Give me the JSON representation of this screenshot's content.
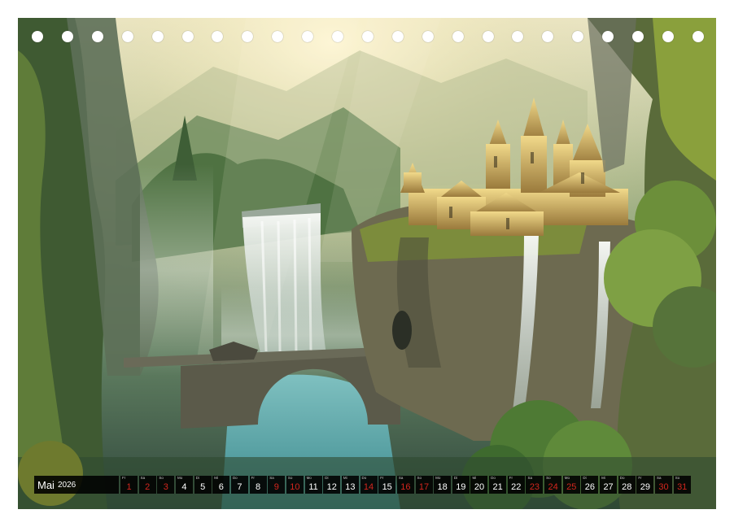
{
  "calendar": {
    "month": "Mai",
    "year": "2026",
    "days": [
      {
        "abbr": "Fr",
        "num": "1",
        "red": true
      },
      {
        "abbr": "Sa",
        "num": "2",
        "red": true
      },
      {
        "abbr": "So",
        "num": "3",
        "red": true
      },
      {
        "abbr": "Mo",
        "num": "4",
        "red": false
      },
      {
        "abbr": "Di",
        "num": "5",
        "red": false
      },
      {
        "abbr": "Mi",
        "num": "6",
        "red": false
      },
      {
        "abbr": "Do",
        "num": "7",
        "red": false
      },
      {
        "abbr": "Fr",
        "num": "8",
        "red": false
      },
      {
        "abbr": "Sa",
        "num": "9",
        "red": true
      },
      {
        "abbr": "So",
        "num": "10",
        "red": true
      },
      {
        "abbr": "Mo",
        "num": "11",
        "red": false
      },
      {
        "abbr": "Di",
        "num": "12",
        "red": false
      },
      {
        "abbr": "Mi",
        "num": "13",
        "red": false
      },
      {
        "abbr": "Do",
        "num": "14",
        "red": true
      },
      {
        "abbr": "Fr",
        "num": "15",
        "red": false
      },
      {
        "abbr": "Sa",
        "num": "16",
        "red": true
      },
      {
        "abbr": "So",
        "num": "17",
        "red": true
      },
      {
        "abbr": "Mo",
        "num": "18",
        "red": false
      },
      {
        "abbr": "Di",
        "num": "19",
        "red": false
      },
      {
        "abbr": "Mi",
        "num": "20",
        "red": false
      },
      {
        "abbr": "Do",
        "num": "21",
        "red": false
      },
      {
        "abbr": "Fr",
        "num": "22",
        "red": false
      },
      {
        "abbr": "Sa",
        "num": "23",
        "red": true
      },
      {
        "abbr": "So",
        "num": "24",
        "red": true
      },
      {
        "abbr": "Mo",
        "num": "25",
        "red": true
      },
      {
        "abbr": "Di",
        "num": "26",
        "red": false
      },
      {
        "abbr": "Mi",
        "num": "27",
        "red": false
      },
      {
        "abbr": "Do",
        "num": "28",
        "red": false
      },
      {
        "abbr": "Fr",
        "num": "29",
        "red": false
      },
      {
        "abbr": "Sa",
        "num": "30",
        "red": true
      },
      {
        "abbr": "So",
        "num": "31",
        "red": true
      }
    ]
  },
  "colors": {
    "holiday": "#d3261e",
    "strip": "#000000"
  }
}
